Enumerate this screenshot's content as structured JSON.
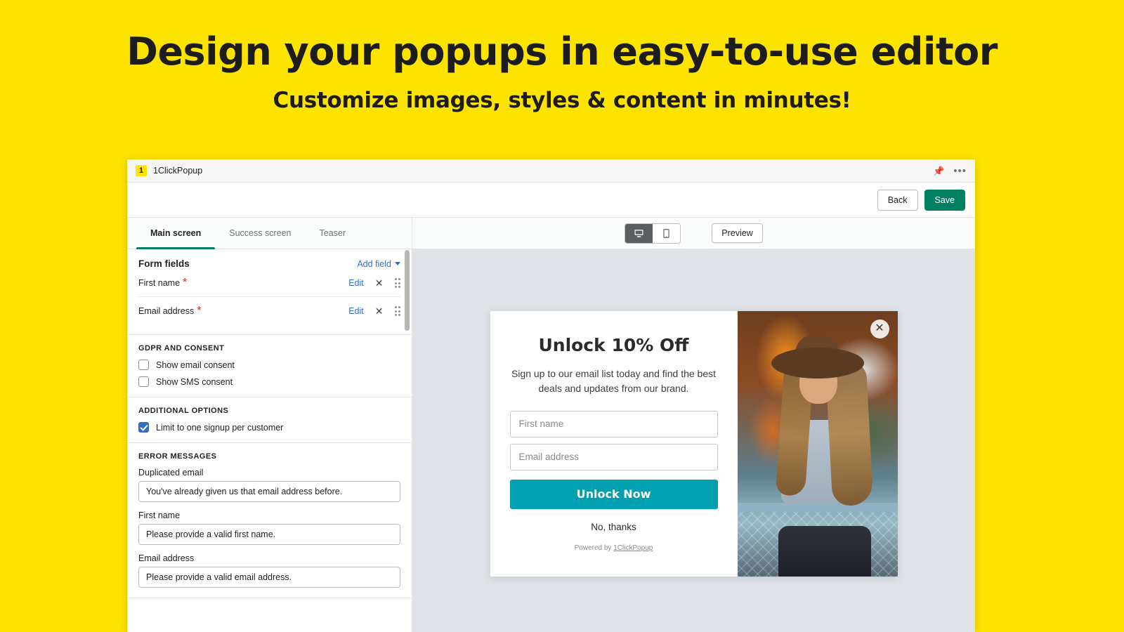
{
  "banner": {
    "headline": "Design your popups in easy-to-use editor",
    "subheadline": "Customize images, styles & content in minutes!",
    "background_color": "#FCE300"
  },
  "app_bar": {
    "badge": "1",
    "title": "1ClickPopup",
    "pin_icon": "pin-icon",
    "more_icon": "•••"
  },
  "action_bar": {
    "back_label": "Back",
    "save_label": "Save",
    "save_color": "#008060"
  },
  "tabs": [
    {
      "label": "Main screen",
      "active": true
    },
    {
      "label": "Success screen",
      "active": false
    },
    {
      "label": "Teaser",
      "active": false
    }
  ],
  "form_fields": {
    "title": "Form fields",
    "add_field_label": "Add field",
    "rows": [
      {
        "name": "First name",
        "required": "*",
        "edit_label": "Edit",
        "remove_label": "✕"
      },
      {
        "name": "Email address",
        "required": "*",
        "edit_label": "Edit",
        "remove_label": "✕"
      }
    ]
  },
  "gdpr": {
    "label": "GDPR AND CONSENT",
    "options": [
      {
        "label": "Show email consent",
        "checked": false
      },
      {
        "label": "Show SMS consent",
        "checked": false
      }
    ]
  },
  "additional_options": {
    "label": "ADDITIONAL OPTIONS",
    "options": [
      {
        "label": "Limit to one signup per customer",
        "checked": true
      }
    ]
  },
  "error_messages": {
    "label": "ERROR MESSAGES",
    "fields": [
      {
        "label": "Duplicated email",
        "value": "You've already given us that email address before."
      },
      {
        "label": "First name",
        "value": "Please provide a valid first name."
      },
      {
        "label": "Email address",
        "value": "Please provide a valid email address."
      }
    ]
  },
  "preview_bar": {
    "desktop_icon": "desktop-icon",
    "mobile_icon": "mobile-icon",
    "active_device": "desktop",
    "preview_label": "Preview"
  },
  "popup": {
    "title": "Unlock 10% Off",
    "subtitle": "Sign up to our email list today and find the best deals and updates from our brand.",
    "inputs": [
      {
        "placeholder": "First name"
      },
      {
        "placeholder": "Email address"
      }
    ],
    "cta_label": "Unlock Now",
    "cta_color": "#00A0B0",
    "dismiss_label": "No, thanks",
    "powered_prefix": "Powered by ",
    "powered_link": "1ClickPopup",
    "close_icon": "✕"
  }
}
